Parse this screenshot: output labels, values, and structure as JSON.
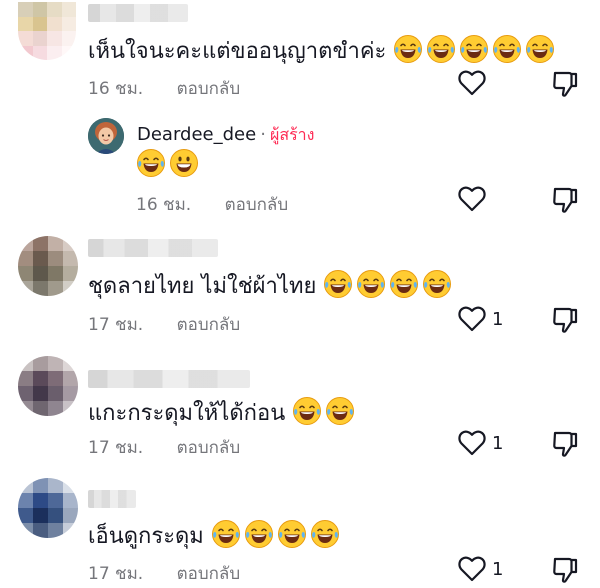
{
  "comments": [
    {
      "text": "เห็นใจนะคะแต่ขออนุญาตขำค่ะ",
      "emojis": [
        "laugh-cry",
        "laugh-cry",
        "laugh-cry",
        "laugh-cry",
        "laugh-cry"
      ],
      "time": "16 ชม.",
      "reply_label": "ตอบกลับ",
      "likes": "",
      "reply": {
        "username": "Deardee_dee",
        "separator": "·",
        "creator_label": "ผู้สร้าง",
        "emojis": [
          "laugh-cry",
          "grin"
        ],
        "time": "16 ชม.",
        "reply_label": "ตอบกลับ",
        "likes": ""
      }
    },
    {
      "text": "ชุดลายไทย ไม่ใช่ผ้าไทย",
      "emojis": [
        "laugh-cry",
        "laugh-cry",
        "laugh-cry",
        "laugh-cry"
      ],
      "time": "17 ชม.",
      "reply_label": "ตอบกลับ",
      "likes": "1"
    },
    {
      "text": "แกะกระดุมให้ได้ก่อน",
      "emojis": [
        "laugh-cry",
        "laugh-cry"
      ],
      "time": "17 ชม.",
      "reply_label": "ตอบกลับ",
      "likes": "1"
    },
    {
      "text": "เอ็นดูกระดุม",
      "emojis": [
        "laugh-cry",
        "laugh-cry",
        "laugh-cry",
        "laugh-cry"
      ],
      "time": "17 ชม.",
      "reply_label": "ตอบกลับ",
      "likes": "1"
    }
  ],
  "icons": {
    "like": "heart-outline-icon",
    "dislike": "thumbs-down-outline-icon"
  },
  "colors": {
    "creator": "#fe2c55",
    "meta": "#75767b",
    "text": "#161823"
  }
}
